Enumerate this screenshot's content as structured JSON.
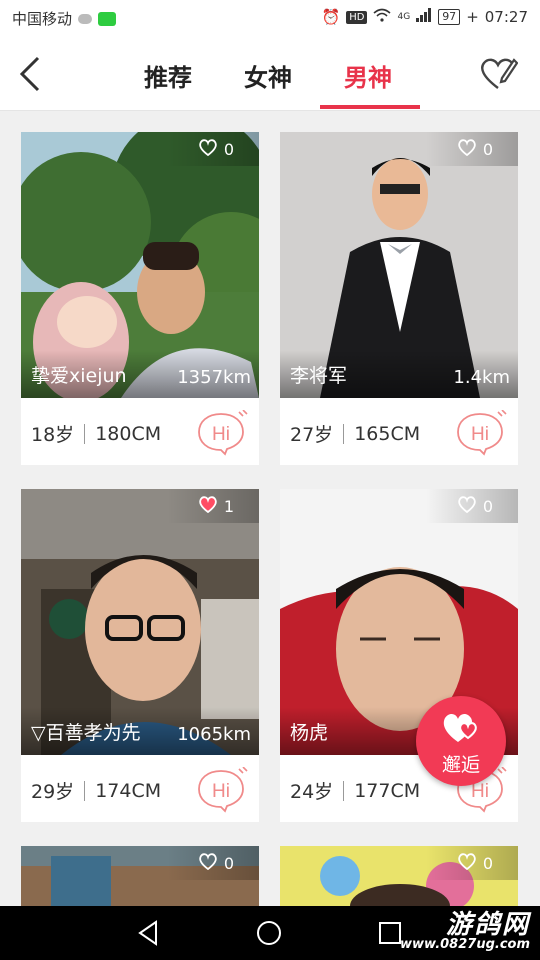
{
  "status_bar": {
    "carrier": "中国移动",
    "network": "4G",
    "battery": "97",
    "time": "07:27",
    "hd_badge": "HD"
  },
  "header": {
    "tabs": [
      {
        "label": "推荐",
        "active": false
      },
      {
        "label": "女神",
        "active": false
      },
      {
        "label": "男神",
        "active": true
      }
    ],
    "accent_color": "#e8334a"
  },
  "cards": [
    {
      "name": "挚爱xiejun",
      "distance": "1357km",
      "age": "18岁",
      "height": "180CM",
      "likes": "0",
      "hi": "Hi"
    },
    {
      "name": "李将军",
      "distance": "1.4km",
      "age": "27岁",
      "height": "165CM",
      "likes": "0",
      "hi": "Hi"
    },
    {
      "name": "▽百善孝为先",
      "distance": "1065km",
      "age": "29岁",
      "height": "174CM",
      "likes": "1",
      "hi": "Hi"
    },
    {
      "name": "杨虎",
      "distance": "",
      "age": "24岁",
      "height": "177CM",
      "likes": "0",
      "hi": "Hi"
    },
    {
      "name": "",
      "distance": "",
      "age": "",
      "height": "",
      "likes": "0",
      "hi": ""
    },
    {
      "name": "",
      "distance": "",
      "age": "",
      "height": "",
      "likes": "0",
      "hi": ""
    }
  ],
  "fab": {
    "label": "邂逅"
  },
  "watermark": {
    "title": "游鸽网",
    "url": "www.0827ug.com"
  }
}
